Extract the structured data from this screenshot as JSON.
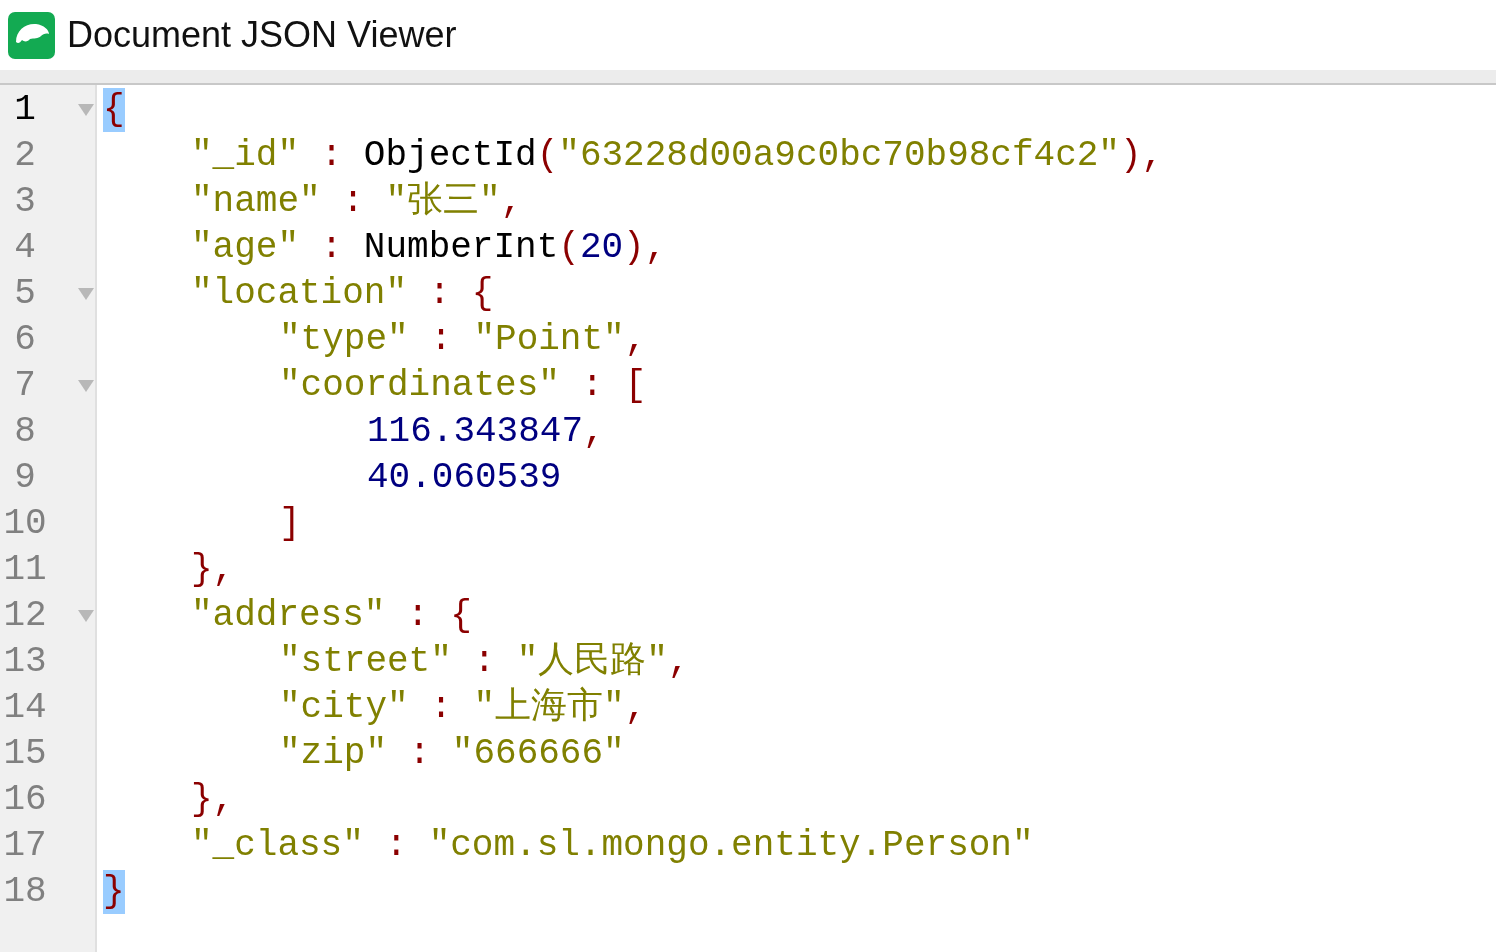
{
  "window": {
    "title": "Document JSON Viewer"
  },
  "lines": [
    {
      "number": "1",
      "current": true,
      "foldable": true,
      "tokens": [
        {
          "kind": "punct",
          "text": "{",
          "matched": true
        }
      ],
      "children": [
        {
          "number": "2",
          "current": false,
          "foldable": false,
          "tokens": [
            {
              "kind": "key",
              "text": "\"_id\""
            },
            {
              "kind": "punct",
              "text": " : "
            },
            {
              "kind": "func",
              "text": "ObjectId"
            },
            {
              "kind": "punct",
              "text": "("
            },
            {
              "kind": "string",
              "text": "\"63228d00a9c0bc70b98cf4c2\""
            },
            {
              "kind": "punct",
              "text": "),"
            }
          ]
        },
        {
          "number": "3",
          "current": false,
          "foldable": false,
          "tokens": [
            {
              "kind": "key",
              "text": "\"name\""
            },
            {
              "kind": "punct",
              "text": " : "
            },
            {
              "kind": "string",
              "text": "\"张三\""
            },
            {
              "kind": "punct",
              "text": ","
            }
          ]
        },
        {
          "number": "4",
          "current": false,
          "foldable": false,
          "tokens": [
            {
              "kind": "key",
              "text": "\"age\""
            },
            {
              "kind": "punct",
              "text": " : "
            },
            {
              "kind": "func",
              "text": "NumberInt"
            },
            {
              "kind": "punct",
              "text": "("
            },
            {
              "kind": "number",
              "text": "20"
            },
            {
              "kind": "punct",
              "text": "),"
            }
          ]
        },
        {
          "number": "5",
          "current": false,
          "foldable": true,
          "tokens": [
            {
              "kind": "key",
              "text": "\"location\""
            },
            {
              "kind": "punct",
              "text": " : {"
            }
          ],
          "children": [
            {
              "number": "6",
              "current": false,
              "foldable": false,
              "tokens": [
                {
                  "kind": "key",
                  "text": "\"type\""
                },
                {
                  "kind": "punct",
                  "text": " : "
                },
                {
                  "kind": "string",
                  "text": "\"Point\""
                },
                {
                  "kind": "punct",
                  "text": ","
                }
              ]
            },
            {
              "number": "7",
              "current": false,
              "foldable": true,
              "tokens": [
                {
                  "kind": "key",
                  "text": "\"coordinates\""
                },
                {
                  "kind": "punct",
                  "text": " : ["
                }
              ],
              "children": [
                {
                  "number": "8",
                  "current": false,
                  "foldable": false,
                  "tokens": [
                    {
                      "kind": "number",
                      "text": "116.343847"
                    },
                    {
                      "kind": "punct",
                      "text": ","
                    }
                  ]
                },
                {
                  "number": "9",
                  "current": false,
                  "foldable": false,
                  "tokens": [
                    {
                      "kind": "number",
                      "text": "40.060539"
                    }
                  ]
                }
              ]
            },
            {
              "number": "10",
              "current": false,
              "foldable": false,
              "tokens": [
                {
                  "kind": "punct",
                  "text": "]"
                }
              ]
            }
          ]
        },
        {
          "number": "11",
          "current": false,
          "foldable": false,
          "tokens": [
            {
              "kind": "punct",
              "text": "},"
            }
          ]
        },
        {
          "number": "12",
          "current": false,
          "foldable": true,
          "tokens": [
            {
              "kind": "key",
              "text": "\"address\""
            },
            {
              "kind": "punct",
              "text": " : {"
            }
          ],
          "children": [
            {
              "number": "13",
              "current": false,
              "foldable": false,
              "tokens": [
                {
                  "kind": "key",
                  "text": "\"street\""
                },
                {
                  "kind": "punct",
                  "text": " : "
                },
                {
                  "kind": "string",
                  "text": "\"人民路\""
                },
                {
                  "kind": "punct",
                  "text": ","
                }
              ]
            },
            {
              "number": "14",
              "current": false,
              "foldable": false,
              "tokens": [
                {
                  "kind": "key",
                  "text": "\"city\""
                },
                {
                  "kind": "punct",
                  "text": " : "
                },
                {
                  "kind": "string",
                  "text": "\"上海市\""
                },
                {
                  "kind": "punct",
                  "text": ","
                }
              ]
            },
            {
              "number": "15",
              "current": false,
              "foldable": false,
              "tokens": [
                {
                  "kind": "key",
                  "text": "\"zip\""
                },
                {
                  "kind": "punct",
                  "text": " : "
                },
                {
                  "kind": "string",
                  "text": "\"666666\""
                }
              ]
            }
          ]
        },
        {
          "number": "16",
          "current": false,
          "foldable": false,
          "tokens": [
            {
              "kind": "punct",
              "text": "},"
            }
          ]
        },
        {
          "number": "17",
          "current": false,
          "foldable": false,
          "tokens": [
            {
              "kind": "key",
              "text": "\"_class\""
            },
            {
              "kind": "punct",
              "text": " : "
            },
            {
              "kind": "string",
              "text": "\"com.sl.mongo.entity.Person\""
            }
          ]
        }
      ]
    },
    {
      "number": "18",
      "current": false,
      "foldable": false,
      "tokens": [
        {
          "kind": "punct",
          "text": "}",
          "matched": true
        }
      ]
    }
  ]
}
